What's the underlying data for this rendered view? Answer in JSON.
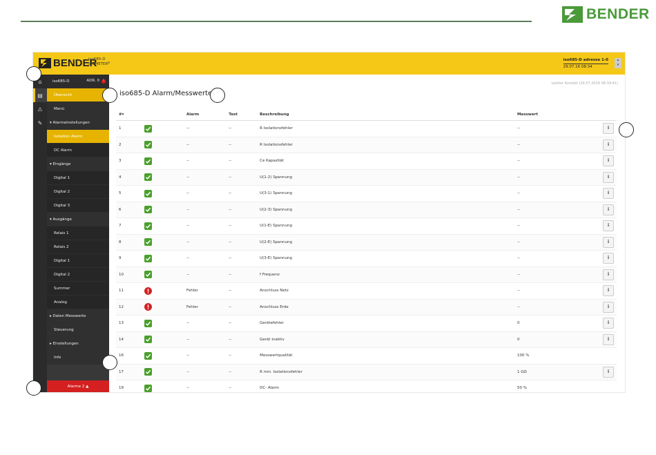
{
  "doc": {
    "brand": "BENDER"
  },
  "app": {
    "brand": "BENDER",
    "device_name": "iso685-D",
    "device_type": "ISOMETER",
    "device_x": "x",
    "address": "iso685-D adresse 1-0",
    "datetime": "29.07.16 08:34",
    "menu_icon": "hamburger-icon"
  },
  "iconbar": {
    "items": [
      "home-icon",
      "device-icon",
      "warning-icon",
      "tools-icon"
    ]
  },
  "sidebar": {
    "device_label": "iso685-D",
    "adr_label": "ADR. 0",
    "adr_badge": "!",
    "items": [
      "Übersicht",
      "Menü",
      "▾ Alarmeinstellungen",
      "Isolation Alarm",
      "DC Alarm",
      "▾ Eingänge",
      "Digital 1",
      "Digital 2",
      "Digital 3",
      "▾ Ausgänge",
      "Relais 1",
      "Relais 2",
      "Digital 1",
      "Digital 2",
      "Summer",
      "Analog",
      "▸ Daten Messwerte",
      "Steuerung",
      "▸ Einstellungen",
      "Info"
    ],
    "alarm_label": "Alarme",
    "alarm_count": "2",
    "alarm_arrow": "▲"
  },
  "main": {
    "last_contact": "Letzter Kontakt (29.07.2016 08:34:41)",
    "title": "iso685-D Alarm/Messwerte"
  },
  "table": {
    "headers": [
      "#▾",
      "",
      "Alarm",
      "Test",
      "Beschreibung",
      "Messwert",
      ""
    ],
    "rows": [
      {
        "n": "1",
        "status": "ok",
        "alarm": "--",
        "test": "--",
        "desc": "R Isolationsfehler",
        "value": "--",
        "info": true
      },
      {
        "n": "2",
        "status": "ok",
        "alarm": "--",
        "test": "--",
        "desc": "R Isolationsfehler",
        "value": "--",
        "info": true
      },
      {
        "n": "3",
        "status": "ok",
        "alarm": "--",
        "test": "--",
        "desc": "Ce Kapazität",
        "value": "--",
        "info": true
      },
      {
        "n": "4",
        "status": "ok",
        "alarm": "--",
        "test": "--",
        "desc": "U(1-2) Spannung",
        "value": "--",
        "info": true
      },
      {
        "n": "5",
        "status": "ok",
        "alarm": "--",
        "test": "--",
        "desc": "U(3-1) Spannung",
        "value": "--",
        "info": true
      },
      {
        "n": "6",
        "status": "ok",
        "alarm": "--",
        "test": "--",
        "desc": "U(2-3) Spannung",
        "value": "--",
        "info": true
      },
      {
        "n": "7",
        "status": "ok",
        "alarm": "--",
        "test": "--",
        "desc": "U(1-E) Spannung",
        "value": "--",
        "info": true
      },
      {
        "n": "8",
        "status": "ok",
        "alarm": "--",
        "test": "--",
        "desc": "U(2-E) Spannung",
        "value": "--",
        "info": true
      },
      {
        "n": "9",
        "status": "ok",
        "alarm": "--",
        "test": "--",
        "desc": "U(3-E) Spannung",
        "value": "--",
        "info": true
      },
      {
        "n": "10",
        "status": "ok",
        "alarm": "--",
        "test": "--",
        "desc": "f Frequenz",
        "value": "--",
        "info": true
      },
      {
        "n": "11",
        "status": "err",
        "alarm": "Fehler",
        "test": "--",
        "desc": "Anschluss Netz",
        "value": "--",
        "info": true
      },
      {
        "n": "12",
        "status": "err",
        "alarm": "Fehler",
        "test": "--",
        "desc": "Anschluss Erde",
        "value": "--",
        "info": true
      },
      {
        "n": "13",
        "status": "ok",
        "alarm": "--",
        "test": "--",
        "desc": "Gerätefehler",
        "value": "0",
        "info": true
      },
      {
        "n": "14",
        "status": "ok",
        "alarm": "--",
        "test": "--",
        "desc": "Gerät inaktiv",
        "value": "0",
        "info": true
      },
      {
        "n": "16",
        "status": "ok",
        "alarm": "--",
        "test": "--",
        "desc": "Messwertqualität",
        "value": "100 %",
        "info": false
      },
      {
        "n": "17",
        "status": "ok",
        "alarm": "--",
        "test": "--",
        "desc": "R min. Isolationsfehler",
        "value": "1 GΩ",
        "info": true
      },
      {
        "n": "19",
        "status": "ok",
        "alarm": "--",
        "test": "--",
        "desc": "DC- Alarm",
        "value": "50 %",
        "info": false
      }
    ],
    "info_label": "i"
  },
  "colors": {
    "accent": "#f5c818",
    "ok": "#4aa02c",
    "error": "#d42020",
    "sidebar": "#383838"
  }
}
